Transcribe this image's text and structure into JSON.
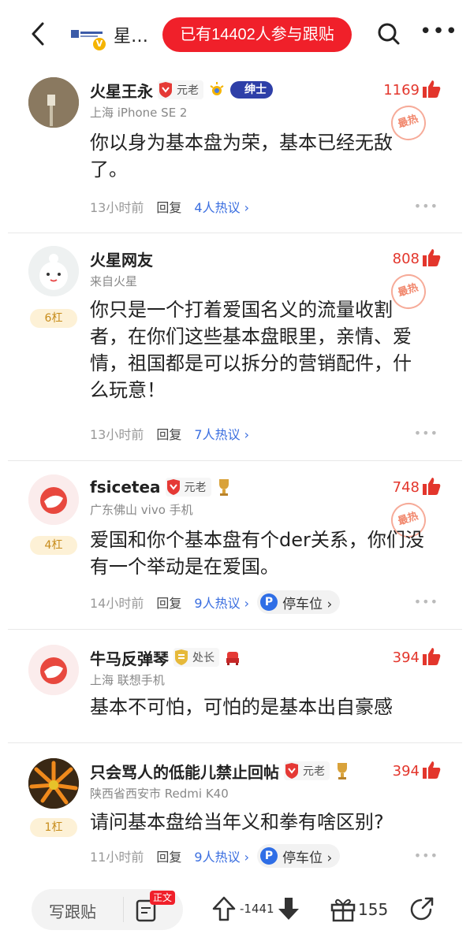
{
  "header": {
    "title_truncated": "星…",
    "join_text": "已有14402人参与跟贴",
    "icons": [
      "back-icon",
      "search-icon",
      "more-icon"
    ]
  },
  "comments": [
    {
      "name": "火星王永",
      "badge": "元老",
      "extra_badge": "绅士",
      "location": "上海  iPhone SE 2",
      "likes": "1169",
      "hot": "最热",
      "text": "你以身为基本盘为荣，基本已经无敌了。",
      "time": "13小时前",
      "reply": "回复",
      "discuss": "4人热议 ›"
    },
    {
      "name": "火星网友",
      "location": "来自火星",
      "floor": "6杠",
      "likes": "808",
      "hot": "最热",
      "text": "你只是一个打着爱国名义的流量收割者，在你们这些基本盘眼里，亲情、爱情，祖国都是可以拆分的营销配件，什么玩意！",
      "time": "13小时前",
      "reply": "回复",
      "discuss": "7人热议 ›"
    },
    {
      "name": "fsicetea",
      "badge": "元老",
      "location": "广东佛山  vivo 手机",
      "floor": "4杠",
      "likes": "748",
      "hot": "最热",
      "text": "爱国和你个基本盘有个der关系，你们没有一个举动是在爱国。",
      "time": "14小时前",
      "reply": "回复",
      "discuss": "9人热议 ›",
      "parking": "停车位 ›"
    },
    {
      "name": "牛马反弹琴",
      "badge": "处长",
      "location": "上海  联想手机",
      "likes": "394",
      "text": "基本不可怕，可怕的是基本出自豪感"
    },
    {
      "name": "只会骂人的低能儿禁止回帖",
      "badge": "元老",
      "location": "陕西省西安市  Redmi K40",
      "floor": "1杠",
      "likes": "394",
      "text": "请问基本盘给当年义和拳有啥区别?",
      "time": "11小时前",
      "reply": "回复",
      "discuss": "9人热议 ›",
      "parking": "停车位 ›"
    }
  ],
  "bottom": {
    "write_label": "写跟贴",
    "body_badge": "正文",
    "vote_count": "-1441",
    "gift_count": "155"
  },
  "colors": {
    "accent_red": "#f0202a",
    "link_blue": "#3a6ee0",
    "floor_gold": "#c78c1b"
  }
}
